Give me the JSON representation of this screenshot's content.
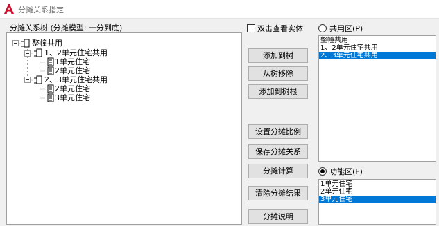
{
  "window": {
    "title": "分摊关系指定"
  },
  "tree": {
    "label": "分摊关系树 (分摊模型: 一分到底)",
    "nodes": [
      {
        "text": "整幢共用",
        "level": 0
      },
      {
        "text": "1、2单元住宅共用",
        "level": 1
      },
      {
        "text": "1单元住宅",
        "level": 2
      },
      {
        "text": "2单元住宅",
        "level": 2
      },
      {
        "text": "2、3单元住宅共用",
        "level": 1
      },
      {
        "text": "2单元住宅",
        "level": 2
      },
      {
        "text": "3单元住宅",
        "level": 2
      }
    ]
  },
  "options": {
    "double_click_label": "双击查看实体"
  },
  "buttons": {
    "add_to_tree": "添加到树",
    "remove_from_tree": "从树移除",
    "add_to_root": "添加到树根",
    "set_ratio": "设置分摊比例",
    "save_relation": "保存分摊关系",
    "calculate": "分摊计算",
    "clear_result": "清除分摊结果",
    "explain": "分摊说明"
  },
  "shared_area": {
    "label": "共用区(P)",
    "items": [
      "整幢共用",
      "1、2单元住宅共用",
      "2、3单元住宅共用"
    ],
    "selected": 2
  },
  "function_area": {
    "label": "功能区(F)",
    "items": [
      "1单元住宅",
      "2单元住宅",
      "3单元住宅"
    ],
    "selected": 2
  },
  "colors": {
    "selection": "#0078d7",
    "app_icon": "#c8102e"
  }
}
